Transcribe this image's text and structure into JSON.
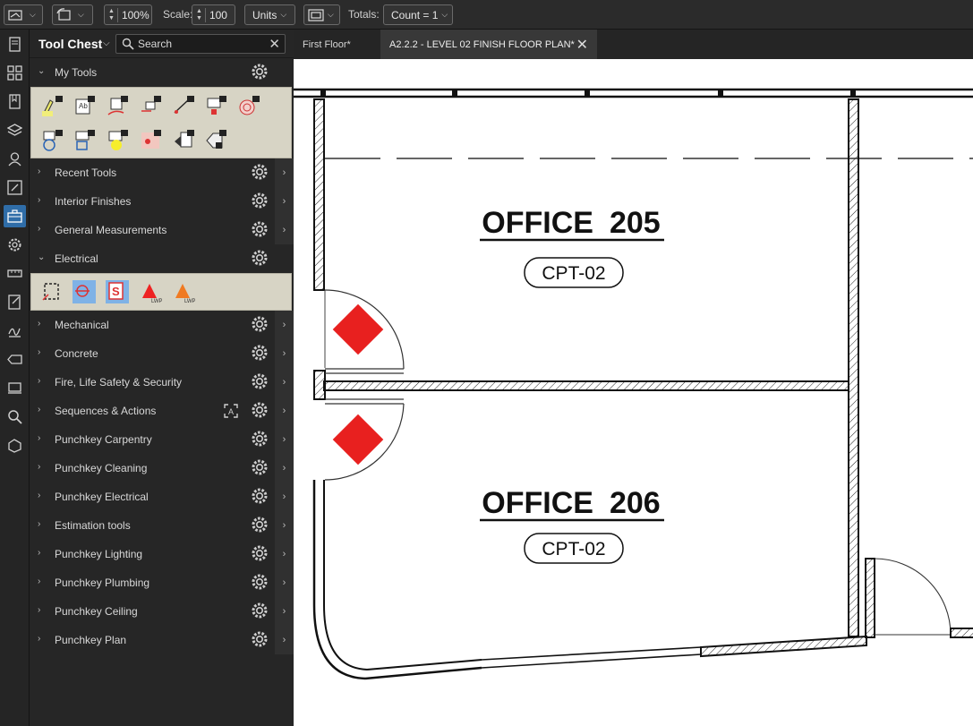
{
  "toolbar": {
    "zoom": "100%",
    "scale_label": "Scale:",
    "scale_value": "100",
    "units_label": "Units",
    "totals_label": "Totals:",
    "totals_value": "Count = 1"
  },
  "rail": {
    "icons": [
      "thumbnails-icon",
      "grid-icon",
      "bookmarks-icon",
      "layers-icon",
      "places-icon",
      "markups-list-icon",
      "tool-chest-icon",
      "properties-icon",
      "measurements-icon",
      "forms-icon",
      "signatures-icon",
      "tag-icon",
      "file-access-icon",
      "search-icon",
      "spaces-icon"
    ],
    "active": "tool-chest-icon"
  },
  "panel": {
    "title": "Tool Chest",
    "search_placeholder": "Search",
    "sections": [
      {
        "label": "My Tools",
        "expanded": true
      },
      {
        "label": "Recent Tools",
        "expanded": false
      },
      {
        "label": "Interior Finishes",
        "expanded": false
      },
      {
        "label": "General Measurements",
        "expanded": false
      },
      {
        "label": "Electrical",
        "expanded": true
      },
      {
        "label": "Mechanical",
        "expanded": false
      },
      {
        "label": "Concrete",
        "expanded": false
      },
      {
        "label": "Fire, Life Safety & Security",
        "expanded": false
      },
      {
        "label": "Sequences & Actions",
        "expanded": false
      },
      {
        "label": "Punchkey Carpentry",
        "expanded": false
      },
      {
        "label": "Punchkey Cleaning",
        "expanded": false
      },
      {
        "label": "Punchkey Electrical",
        "expanded": false
      },
      {
        "label": "Estimation tools",
        "expanded": false
      },
      {
        "label": "Punchkey Lighting",
        "expanded": false
      },
      {
        "label": "Punchkey Plumbing",
        "expanded": false
      },
      {
        "label": "Punchkey Ceiling",
        "expanded": false
      },
      {
        "label": "Punchkey Plan",
        "expanded": false
      }
    ]
  },
  "tabs": [
    {
      "label": "First Floor*",
      "active": false
    },
    {
      "label": "A2.2.2 - LEVEL 02 FINISH FLOOR PLAN*",
      "active": true
    }
  ],
  "plan": {
    "rooms": [
      {
        "name": "OFFICE",
        "number": "205",
        "finish": "CPT-02"
      },
      {
        "name": "OFFICE",
        "number": "206",
        "finish": "CPT-02"
      }
    ],
    "marker_color": "#e8201f"
  },
  "colors": {
    "accent": "#2f6da8",
    "tray": "#d7d4c5",
    "panel": "#262626"
  }
}
